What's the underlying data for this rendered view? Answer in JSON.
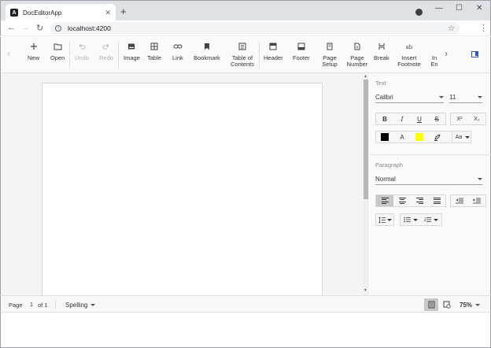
{
  "browser": {
    "tab_title": "DocEditorApp",
    "tab_favicon_letter": "A",
    "tab_close": "✕",
    "new_tab": "+",
    "url": "localhost:4200",
    "back": "←",
    "forward": "→",
    "reload": "↻",
    "star": "☆",
    "menu": "⋮",
    "minimize": "—",
    "maximize": "☐",
    "close": "✕"
  },
  "toolbar": {
    "scroll_left": "‹",
    "scroll_right": "›",
    "items": [
      {
        "label": "New",
        "icon": "plus-icon",
        "disabled": false
      },
      {
        "label": "Open",
        "icon": "folder-icon",
        "disabled": false
      },
      {
        "label": "Undo",
        "icon": "undo-icon",
        "disabled": true
      },
      {
        "label": "Redo",
        "icon": "redo-icon",
        "disabled": true
      },
      {
        "label": "Image",
        "icon": "image-icon",
        "disabled": false
      },
      {
        "label": "Table",
        "icon": "table-icon",
        "disabled": false
      },
      {
        "label": "Link",
        "icon": "link-icon",
        "disabled": false
      },
      {
        "label": "Bookmark",
        "icon": "bookmark-icon",
        "disabled": false
      },
      {
        "label": "Table of Contents",
        "icon": "toc-icon",
        "disabled": false
      },
      {
        "label": "Header",
        "icon": "header-icon",
        "disabled": false
      },
      {
        "label": "Footer",
        "icon": "footer-icon",
        "disabled": false
      },
      {
        "label": "Page Setup",
        "icon": "page-setup-icon",
        "disabled": false
      },
      {
        "label": "Page Number",
        "icon": "page-number-icon",
        "disabled": false
      },
      {
        "label": "Break",
        "icon": "break-icon",
        "disabled": false
      },
      {
        "label": "Insert Footnote",
        "icon": "footnote-icon",
        "disabled": false
      },
      {
        "label": "In En",
        "icon": "endnote-icon",
        "disabled": false
      }
    ]
  },
  "pane": {
    "text_heading": "Text",
    "font_family": "Calibri",
    "font_size": "11",
    "bold": "B",
    "italic": "I",
    "underline": "U",
    "strikethrough": "S",
    "superscript": "X²",
    "subscript": "X₂",
    "font_color_label": "A",
    "change_case": "Aa",
    "colors": {
      "font": "#000000",
      "highlight": "#ffff00",
      "accent": "#2b54c4"
    },
    "paragraph_heading": "Paragraph",
    "style": "Normal"
  },
  "status": {
    "page_label": "Page",
    "page_current": "1",
    "page_total": "of 1",
    "spelling": "Spelling",
    "zoom": "75%"
  }
}
